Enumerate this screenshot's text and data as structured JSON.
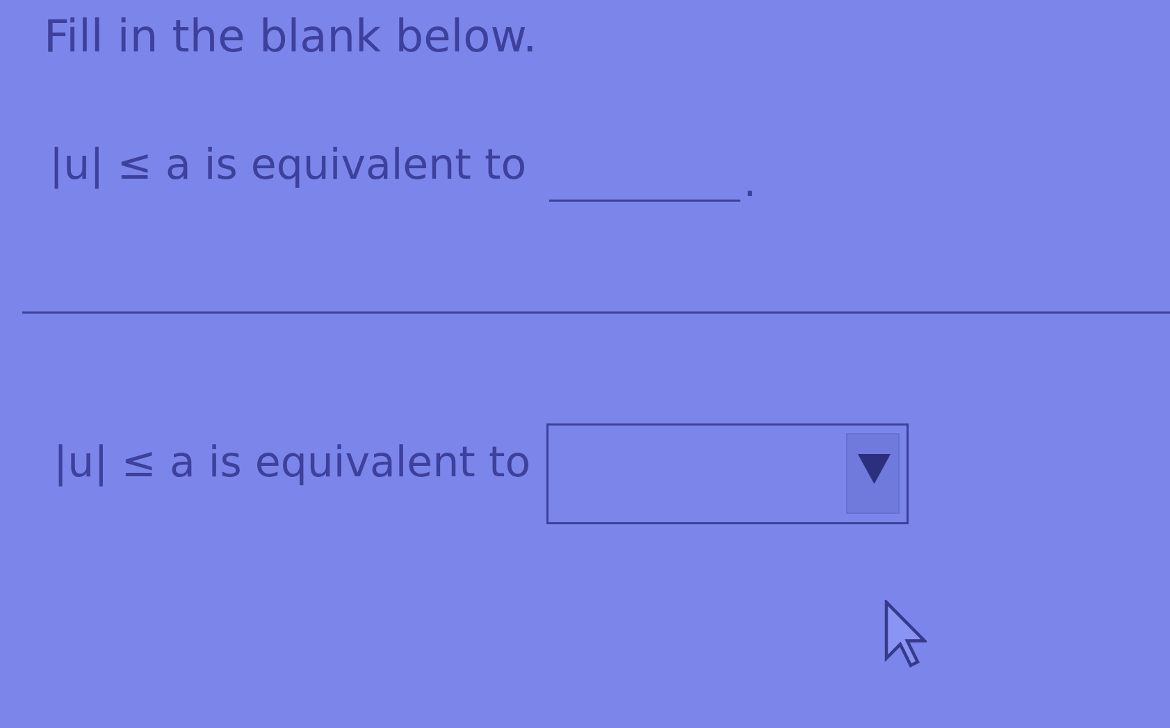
{
  "instruction": "Fill in the blank below.",
  "statement": {
    "parts": [
      {
        "kind": "text",
        "text": "|u| ≤ a is equivalent to"
      },
      {
        "kind": "blank"
      },
      {
        "kind": "punctuation",
        "text": "."
      }
    ]
  },
  "answer": {
    "parts": [
      {
        "kind": "text",
        "text": "|u| ≤ a is equivalent to"
      },
      {
        "kind": "dropdown"
      }
    ]
  }
}
